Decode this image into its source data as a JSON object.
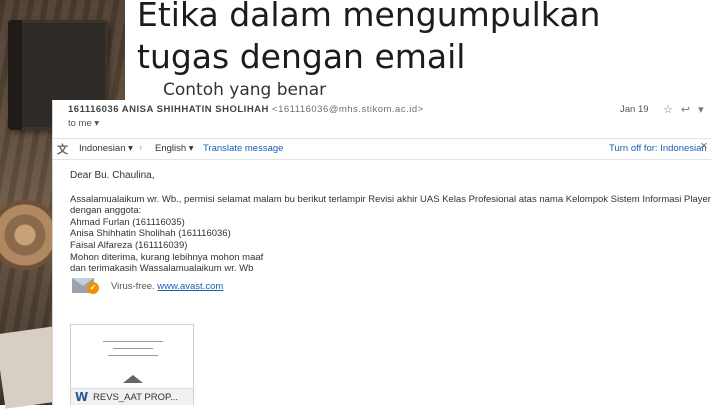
{
  "slide": {
    "title_line1": "Etika dalam mengumpulkan",
    "title_line2": "tugas dengan email",
    "subtitle": "Contoh yang benar"
  },
  "email": {
    "sender_name": "161116036 ANISA SHIHHATIN SHOLIHAH",
    "sender_address": "<161116036@mhs.stikom.ac.id>",
    "recipient": "to me",
    "date": "Jan 19",
    "translate_bar": {
      "source_lang": "Indonesian",
      "target_lang": "English",
      "translate_label": "Translate message",
      "turn_off_label": "Turn off for: Indonesian"
    },
    "greeting": "Dear Bu. Chaulina,",
    "body_lines": [
      "Assalamualaikum wr. Wb., permisi selamat malam bu berikut terlampir Revisi akhir UAS Kelas Profesional atas nama Kelompok Sistem Informasi Player Scouting",
      "dengan anggota:",
      "Ahmad Furlan (161116035)",
      "Anisa Shihhatin Sholihah (161116036)",
      "Faisal Alfareza (161116039)",
      "Mohon diterima, kurang lebihnya mohon maaf",
      "dan terimakasih Wassalamualaikum wr. Wb"
    ],
    "virus_free_text": "Virus-free.",
    "virus_free_link": "www.avast.com",
    "attachment_name": "REVS_AAT PROP...",
    "attachment_icon": "W"
  },
  "colors": {
    "link": "#1a5fb4",
    "avast_orange": "#f29100",
    "word_blue": "#2b579a"
  }
}
